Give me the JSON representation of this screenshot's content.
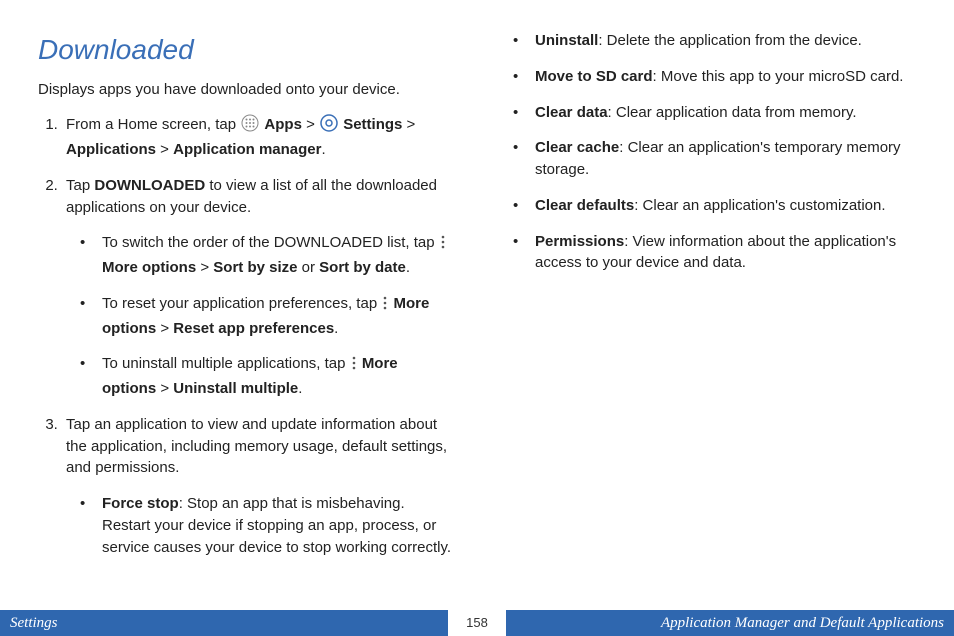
{
  "heading": "Downloaded",
  "intro": "Displays apps you have downloaded onto your device.",
  "step1": {
    "prefix": "From a Home screen, tap ",
    "apps": "Apps",
    "gt1": " > ",
    "settings": "Settings",
    "gt2": " > ",
    "applications": "Applications",
    "gt3": " > ",
    "appmgr": "Application manager",
    "period": "."
  },
  "step2": {
    "prefix": "Tap ",
    "downloaded": "DOWNLOADED",
    "suffix": " to view a list of all the downloaded applications on your device."
  },
  "sub": {
    "a": {
      "prefix": "To switch the order of the DOWNLOADED list, tap ",
      "more": "More options",
      "gt": " > ",
      "sortsize": "Sort by size",
      "or": " or ",
      "sortdate": "Sort by date",
      "period": "."
    },
    "b": {
      "prefix": "To reset your application preferences, tap ",
      "more": "More options",
      "gt": " > ",
      "reset": "Reset app preferences",
      "period": "."
    },
    "c": {
      "prefix": "To uninstall multiple applications, tap ",
      "more": "More options",
      "gt": " > ",
      "uninst": "Uninstall multiple",
      "period": "."
    }
  },
  "step3": "Tap an application to view and update information about the application, including memory usage, default settings, and permissions.",
  "opts": {
    "forcestop": {
      "label": "Force stop",
      "desc": ": Stop an app that is misbehaving. Restart your device if stopping an app, process, or service causes your device to stop working correctly."
    },
    "uninstall": {
      "label": "Uninstall",
      "desc": ": Delete the application from the device."
    },
    "movesd": {
      "label": "Move to SD card",
      "desc": ": Move this app to your microSD card."
    },
    "cleardata": {
      "label": "Clear data",
      "desc": ": Clear application data from memory."
    },
    "clearcache": {
      "label": "Clear cache",
      "desc": ": Clear an application's temporary memory storage."
    },
    "cleardefaults": {
      "label": "Clear defaults",
      "desc": ": Clear an application's customization."
    },
    "permissions": {
      "label": "Permissions",
      "desc": ": View information about the application's access to your device and data."
    }
  },
  "footer": {
    "left": "Settings",
    "center": "158",
    "right": "Application Manager and Default Applications"
  }
}
